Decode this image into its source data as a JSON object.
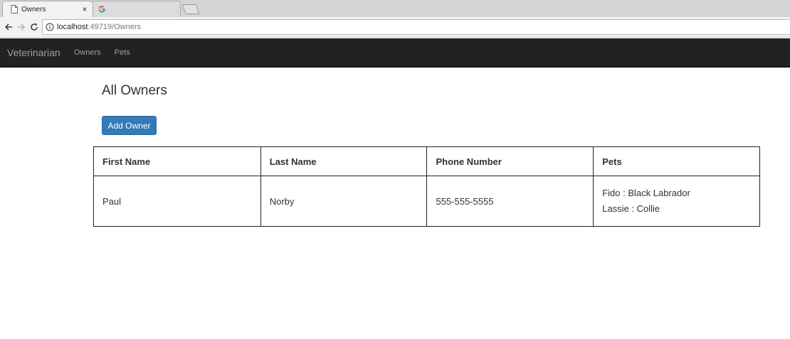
{
  "browser": {
    "tabs": [
      {
        "title": "Owners",
        "close": "×",
        "icon": "page-icon"
      },
      {
        "title": "",
        "icon": "google-icon"
      }
    ],
    "address": {
      "host": "localhost",
      "path": ":49719/Owners"
    }
  },
  "navbar": {
    "brand": "Veterinarian",
    "links": [
      "Owners",
      "Pets"
    ]
  },
  "page": {
    "title": "All Owners",
    "add_button": "Add Owner"
  },
  "table": {
    "headers": [
      "First Name",
      "Last Name",
      "Phone Number",
      "Pets"
    ],
    "rows": [
      {
        "first_name": "Paul",
        "last_name": "Norby",
        "phone": "555-555-5555",
        "pets": [
          "Fido : Black Labrador",
          "Lassie : Collie"
        ]
      }
    ]
  },
  "colors": {
    "navbar_bg": "#222222",
    "primary_button": "#337ab7"
  }
}
